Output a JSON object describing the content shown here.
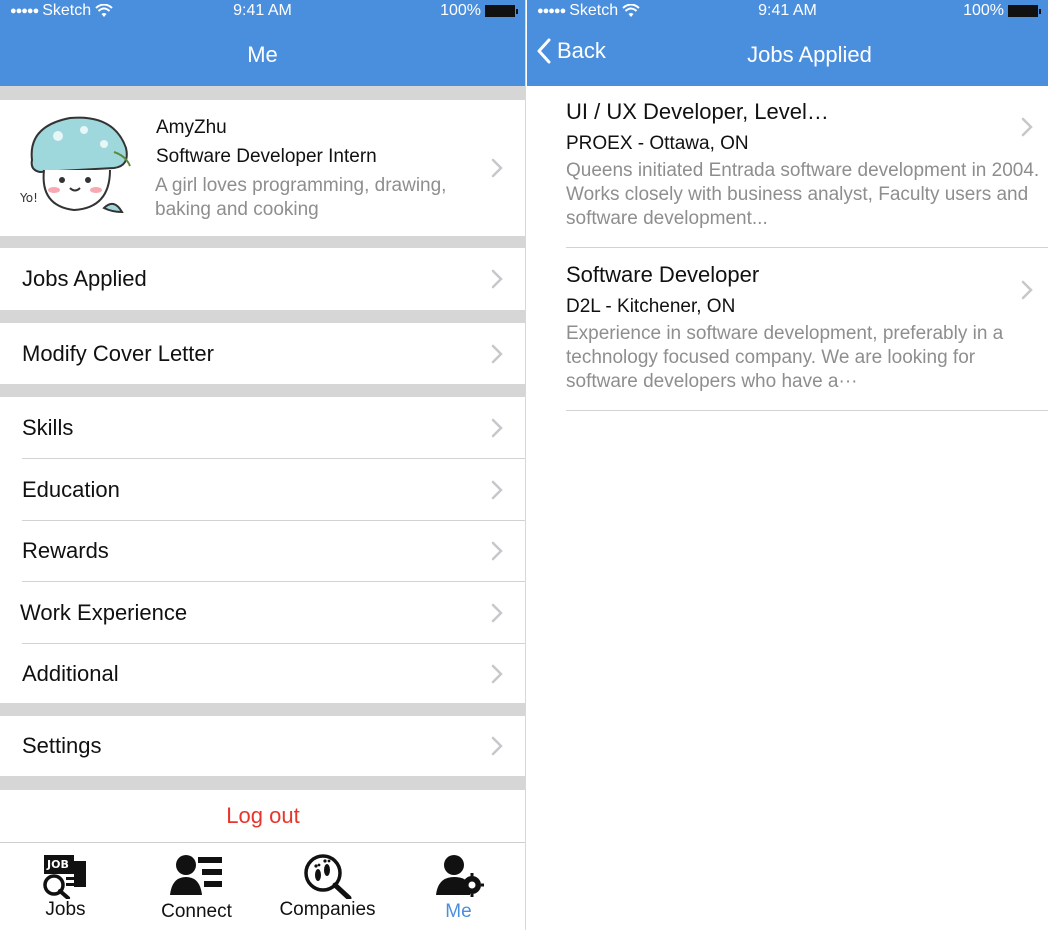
{
  "status": {
    "carrier": "Sketch",
    "time": "9:41 AM",
    "battery": "100%"
  },
  "me": {
    "title": "Me",
    "profile": {
      "name": "AmyZhu",
      "role": "Software Developer Intern",
      "bio": "A girl loves programming, drawing, baking and cooking"
    },
    "menu": [
      {
        "label": "Jobs Applied"
      },
      {
        "label": "Modify Cover Letter"
      },
      {
        "label": "Skills"
      },
      {
        "label": "Education"
      },
      {
        "label": "Rewards"
      },
      {
        "label": "Work Experience"
      },
      {
        "label": "Additional"
      },
      {
        "label": "Settings"
      }
    ],
    "logout": "Log out",
    "tabs": [
      {
        "label": "Jobs",
        "icon": "jobs-icon"
      },
      {
        "label": "Connect",
        "icon": "connect-icon"
      },
      {
        "label": "Companies",
        "icon": "companies-icon"
      },
      {
        "label": "Me",
        "icon": "me-icon",
        "active": true
      }
    ]
  },
  "jobs_applied": {
    "back": "Back",
    "title": "Jobs Applied",
    "jobs": [
      {
        "title": "UI / UX Developer, Level…",
        "company": "PROEX - Ottawa, ON",
        "description": "Queens initiated Entrada software development in 2004. Works closely with business analyst, Faculty users and software development..."
      },
      {
        "title": "Software Developer",
        "company": "D2L - Kitchener, ON",
        "description": "Experience in software development, preferably in a technology focused company. We are looking for software developers who have a···"
      }
    ]
  },
  "colors": {
    "nav": "#4a8ede",
    "logout": "#e8352b",
    "active_tab": "#4a8ede",
    "muted_text": "#8e8e8e"
  }
}
